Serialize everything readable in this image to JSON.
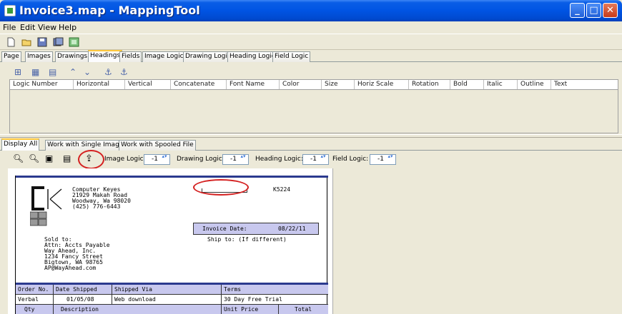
{
  "window": {
    "title": "Invoice3.map - MappingTool"
  },
  "menu": [
    "File",
    "Edit",
    "View",
    "Help"
  ],
  "top_tabs": [
    "Page",
    "Images",
    "Drawings",
    "Headings",
    "Fields",
    "Image Logic",
    "Drawing Logic",
    "Heading Logic",
    "Field Logic"
  ],
  "active_top_tab": "Headings",
  "columns": [
    "Logic Number",
    "Horizontal",
    "Vertical",
    "Concatenate",
    "Font Name",
    "Color",
    "Size",
    "Horiz Scale",
    "Rotation",
    "Bold",
    "Italic",
    "Outline",
    "Text"
  ],
  "bottom_tabs": [
    "Display All",
    "Work with Single Image",
    "Work with Spooled File"
  ],
  "active_bottom_tab": "Display All",
  "logic": {
    "image_label": "Image Logic:",
    "image_value": "-1",
    "drawing_label": "Drawing Logic:",
    "drawing_value": "-1",
    "heading_label": "Heading Logic:",
    "heading_value": "-1",
    "field_label": "Field Logic:",
    "field_value": "-1"
  },
  "invoice": {
    "company": [
      "Computer Keyes",
      "21929 Makah Road",
      "Woodway, Wa  98020",
      "(425) 776-6443"
    ],
    "doc_code": "K5224",
    "invoice_date_label": "Invoice Date:",
    "invoice_date": "08/22/11",
    "sold_to": [
      "Sold to:",
      "Attn: Accts Payable",
      "Way Ahead, Inc.",
      "1234 Fancy Street",
      "Bigtown, WA  98765",
      "AP@WayAhead.com"
    ],
    "ship_to": "Ship to: (If different)",
    "header_row": [
      "Order No.",
      "Date Shipped",
      "Shipped Via",
      "Terms"
    ],
    "data_row": [
      "Verbal",
      "01/05/08",
      "Web download",
      "30 Day Free Trial"
    ],
    "item_header": [
      "Qty",
      "Description",
      "Unit Price",
      "Total"
    ]
  },
  "colors": {
    "title_bar": "#0054e3",
    "highlight_circle": "#d42020",
    "invoice_band": "#2b3a8f",
    "date_box": "#c8c8ee"
  }
}
